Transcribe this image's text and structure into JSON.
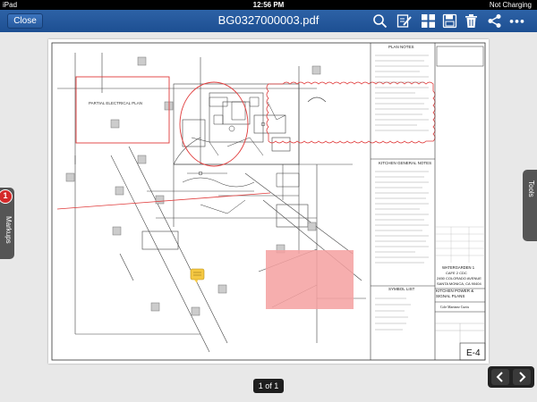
{
  "status_bar": {
    "device": "iPad",
    "time": "12:56 PM",
    "battery": "Not Charging"
  },
  "toolbar": {
    "close_label": "Close",
    "file_name": "BG0327000003.pdf",
    "icons": [
      "search-icon",
      "annotate-icon",
      "grid-icon",
      "save-icon",
      "trash-icon",
      "share-icon",
      "more-icon"
    ]
  },
  "side_tabs": {
    "markups_label": "Markups",
    "markups_count": "1",
    "tools_label": "Tools"
  },
  "drawing": {
    "plan_notes_title": "PLAN NOTES",
    "kitchen_notes_title": "KITCHEN GENERAL NOTES",
    "symbol_list_title": "SYMBOL LIST",
    "partial_plan_label": "PARTIAL ELECTRICAL PLAN",
    "project_name": "WATERGARDEN 1",
    "project_sub": "CAFE 2 CDC",
    "project_address": "2450 COLORADO AVENUE",
    "project_city": "SANTA MONICA, CA 90404",
    "sheet_title": "KITCHEN POWER & SIGNAL PLANS",
    "client": "Cole Martinez Curtis",
    "sheet_number": "E-4"
  },
  "footer": {
    "page_indicator": "1 of 1"
  },
  "colors": {
    "toolbar": "#1d4f92",
    "markup_red": "#e03a3a",
    "markup_fill": "#f4a0a0",
    "note_yellow": "#f5c842"
  }
}
